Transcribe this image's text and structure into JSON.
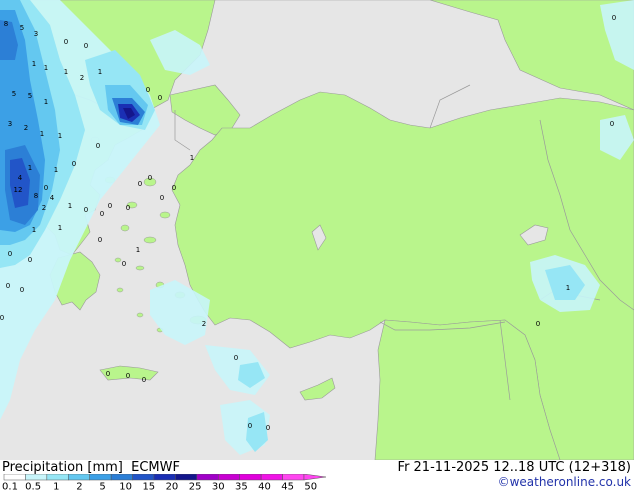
{
  "footer": {
    "title": "Precipitation [mm]  ECMWF",
    "datetime": "Fr 21-11-2025 12..18 UTC (12+318)",
    "credit": "©weatheronline.co.uk"
  },
  "legend": {
    "labels": [
      "0.1",
      "0.5",
      "1",
      "2",
      "5",
      "10",
      "15",
      "20",
      "25",
      "30",
      "35",
      "40",
      "45",
      "50"
    ],
    "colors": [
      "#ffffff",
      "#c8f5fa",
      "#96e6f5",
      "#64c8f0",
      "#3ca0e6",
      "#2c7fd6",
      "#2255c8",
      "#1a2fb4",
      "#14168c",
      "#a000c8",
      "#c800d2",
      "#e000dc",
      "#f014e6",
      "#ff46f0"
    ]
  },
  "map_values": [
    {
      "text": "8"
    },
    {
      "text": "5"
    },
    {
      "text": "3"
    },
    {
      "text": "0"
    },
    {
      "text": "0"
    },
    {
      "text": "1"
    },
    {
      "text": "1"
    },
    {
      "text": "1"
    },
    {
      "text": "2"
    },
    {
      "text": "1"
    },
    {
      "text": "5"
    },
    {
      "text": "5"
    },
    {
      "text": "1"
    },
    {
      "text": "0"
    },
    {
      "text": "0"
    },
    {
      "text": "3"
    },
    {
      "text": "2"
    },
    {
      "text": "1"
    },
    {
      "text": "1"
    },
    {
      "text": "0"
    },
    {
      "text": "0"
    },
    {
      "text": "1"
    },
    {
      "text": "4"
    },
    {
      "text": "1"
    },
    {
      "text": "0"
    },
    {
      "text": "12"
    },
    {
      "text": "8"
    },
    {
      "text": "4"
    },
    {
      "text": "2"
    },
    {
      "text": "1"
    },
    {
      "text": "1"
    },
    {
      "text": "0"
    },
    {
      "text": "1"
    },
    {
      "text": "0"
    },
    {
      "text": "0"
    },
    {
      "text": "0"
    },
    {
      "text": "0"
    },
    {
      "text": "0"
    },
    {
      "text": "0"
    },
    {
      "text": "2"
    },
    {
      "text": "1"
    },
    {
      "text": "0"
    },
    {
      "text": "0"
    },
    {
      "text": "0"
    },
    {
      "text": "0"
    },
    {
      "text": "0"
    },
    {
      "text": "0"
    },
    {
      "text": "1"
    },
    {
      "text": "0"
    },
    {
      "text": "0"
    },
    {
      "text": "0"
    },
    {
      "text": "0"
    },
    {
      "text": "0"
    },
    {
      "text": "0"
    },
    {
      "text": "0"
    },
    {
      "text": "0"
    },
    {
      "text": "0"
    },
    {
      "text": "1"
    },
    {
      "text": "0"
    },
    {
      "text": "0"
    }
  ]
}
